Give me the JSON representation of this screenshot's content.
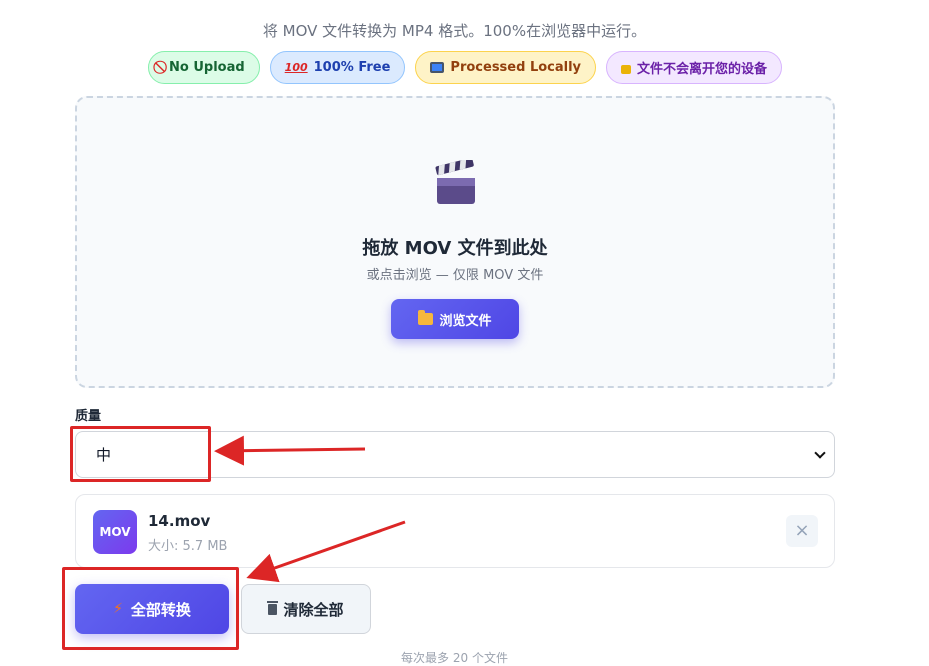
{
  "subtitle": "将 MOV 文件转换为 MP4 格式。100%在浏览器中运行。",
  "badges": [
    {
      "icon": "ban-icon",
      "label": "No Upload"
    },
    {
      "icon": "hundred-icon",
      "label": "100% Free"
    },
    {
      "icon": "monitor-icon",
      "label": "Processed Locally"
    },
    {
      "icon": "lock-icon",
      "label": "文件不会离开您的设备"
    }
  ],
  "dropzone": {
    "icon": "clapperboard-icon",
    "title": "拖放 MOV 文件到此处",
    "hint": "或点击浏览 — 仅限 MOV 文件",
    "browse_label": "浏览文件"
  },
  "quality": {
    "label": "质量",
    "selected": "中"
  },
  "file": {
    "badge": "MOV",
    "name": "14.mov",
    "size": "大小: 5.7 MB",
    "remove_symbol": "×"
  },
  "actions": {
    "convert_label": "全部转换",
    "clear_label": "清除全部"
  },
  "footer_note": "每次最多 20 个文件",
  "colors": {
    "accent": "#4f46e5",
    "annotation": "#dc2626"
  }
}
